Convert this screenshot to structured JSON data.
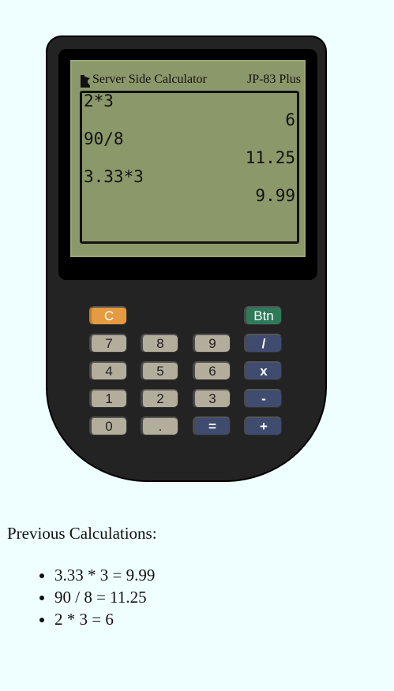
{
  "calculator": {
    "brand": "Server Side Calculator",
    "model": "JP-83 Plus",
    "display": [
      {
        "expression": "2*3",
        "result": "6"
      },
      {
        "expression": "90/8",
        "result": "11.25"
      },
      {
        "expression": "3.33*3",
        "result": "9.99"
      }
    ],
    "keys": {
      "clear": "C",
      "btn": "Btn",
      "seven": "7",
      "eight": "8",
      "nine": "9",
      "divide": "/",
      "four": "4",
      "five": "5",
      "six": "6",
      "multiply": "x",
      "one": "1",
      "two": "2",
      "three": "3",
      "minus": "-",
      "zero": "0",
      "dot": ".",
      "equals": "=",
      "plus": "+"
    },
    "colors": {
      "body": "#232323",
      "screen": "#8b986a",
      "number_key": "#b3ad9c",
      "operator_key": "#3f4c70",
      "clear_key": "#e59b40",
      "btn_key": "#2d7a5a"
    },
    "logo_icon": "minnesota-state-icon"
  },
  "history": {
    "title": "Previous Calculations:",
    "items": [
      "3.33 * 3 = 9.99",
      "90 / 8 = 11.25",
      "2 * 3 = 6"
    ]
  }
}
